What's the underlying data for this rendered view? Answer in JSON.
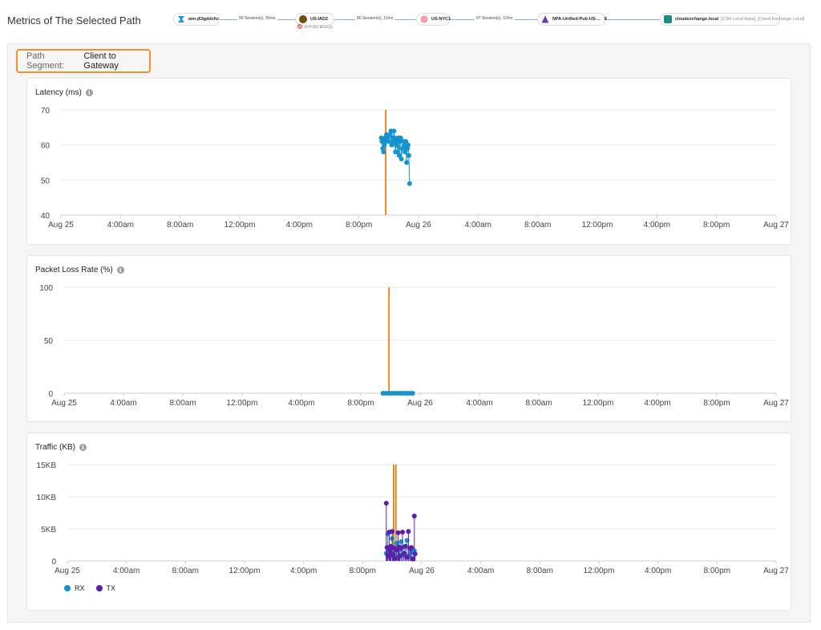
{
  "page_title": "Metrics of The Selected Path",
  "path": {
    "nodes": [
      {
        "id": "client",
        "label": "win-j63gddchz",
        "sub": "",
        "icon": "laptop-icon",
        "color": "#1e9ad6"
      },
      {
        "id": "gateway",
        "label": "US-IAD2",
        "sub": "",
        "icon": "gateway-icon",
        "color": "#7a4a12"
      },
      {
        "id": "pop",
        "label": "US-NYC1",
        "sub": "",
        "icon": "pop-icon",
        "color": "#f2a0b0"
      },
      {
        "id": "publisher",
        "label": "NPA-Unified-Pub-US-...",
        "sub": "",
        "icon": "publisher-icon",
        "color": "#6a3bb0"
      },
      {
        "id": "app",
        "label": "cloudexchange.local",
        "sub": "[CSH Local Apps], [Cloud Exchange Local]",
        "icon": "app-icon",
        "color": "#1a8a8a"
      }
    ],
    "connections": [
      "90 Session(s), 56ms",
      "80 Session(s), 11ms",
      "97 Session(s), 12ms",
      ""
    ],
    "policy_block": "10 Policy Block(s)",
    "publisher_count": "8"
  },
  "segment": {
    "label": "Path Segment:",
    "value": "Client to Gateway"
  },
  "colors": {
    "accent": "#f0912d",
    "rx": "#1593cc",
    "tx": "#5b1fa8",
    "marker": "#e8892a",
    "grid": "#e9e9e9"
  },
  "x_ticks": [
    "Aug 25",
    "4:00am",
    "8:00am",
    "12:00pm",
    "4:00pm",
    "8:00pm",
    "Aug 26",
    "4:00am",
    "8:00am",
    "12:00pm",
    "4:00pm",
    "8:00pm",
    "Aug 27"
  ],
  "chart_data": [
    {
      "type": "scatter",
      "title": "Latency (ms)",
      "ylim": [
        40,
        70
      ],
      "yticks": [
        "40",
        "50",
        "60",
        "70"
      ],
      "marker_hour": 21.8,
      "series": [
        {
          "values": [
            [
              21.5,
              62
            ],
            [
              21.55,
              61
            ],
            [
              21.6,
              59
            ],
            [
              21.65,
              58
            ],
            [
              21.7,
              60
            ],
            [
              21.75,
              62
            ],
            [
              21.8,
              61
            ],
            [
              21.85,
              63
            ],
            [
              21.9,
              62
            ],
            [
              22.0,
              61
            ],
            [
              22.1,
              63
            ],
            [
              22.15,
              64
            ],
            [
              22.2,
              60
            ],
            [
              22.25,
              62
            ],
            [
              22.3,
              61
            ],
            [
              22.35,
              64
            ],
            [
              22.4,
              62
            ],
            [
              22.45,
              58
            ],
            [
              22.5,
              60
            ],
            [
              22.55,
              61
            ],
            [
              22.6,
              58
            ],
            [
              22.65,
              62
            ],
            [
              22.7,
              57
            ],
            [
              22.75,
              61
            ],
            [
              22.8,
              62
            ],
            [
              22.85,
              56
            ],
            [
              22.9,
              59
            ],
            [
              23.0,
              61
            ],
            [
              23.05,
              60
            ],
            [
              23.1,
              58
            ],
            [
              23.15,
              61
            ],
            [
              23.2,
              55
            ],
            [
              23.25,
              59
            ],
            [
              23.3,
              60
            ],
            [
              23.35,
              57
            ],
            [
              23.4,
              49
            ]
          ]
        }
      ]
    },
    {
      "type": "scatter",
      "title": "Packet Loss Rate (%)",
      "ylim": [
        0,
        100
      ],
      "yticks": [
        "0",
        "50",
        "100"
      ],
      "marker_hour": 21.9,
      "series": [
        {
          "values": [
            [
              21.5,
              0
            ],
            [
              21.7,
              0
            ],
            [
              21.9,
              0
            ],
            [
              22.1,
              0
            ],
            [
              22.3,
              0
            ],
            [
              22.5,
              0
            ],
            [
              22.7,
              0
            ],
            [
              22.9,
              0
            ],
            [
              23.1,
              0
            ],
            [
              23.3,
              0
            ],
            [
              23.5,
              0
            ]
          ]
        }
      ]
    },
    {
      "type": "scatter",
      "title": "Traffic (KB)",
      "ylim": [
        0,
        15
      ],
      "yticks": [
        "0",
        "5KB",
        "10KB",
        "15KB"
      ],
      "marker_hours": [
        22.1,
        22.25
      ],
      "series": [
        {
          "name": "RX",
          "values": [
            [
              21.6,
              1.2
            ],
            [
              21.7,
              4.2
            ],
            [
              21.8,
              0.6
            ],
            [
              21.9,
              2.0
            ],
            [
              22.0,
              3.5
            ],
            [
              22.1,
              0.8
            ],
            [
              22.2,
              1.5
            ],
            [
              22.3,
              2.8
            ],
            [
              22.4,
              0.5
            ],
            [
              22.5,
              1.8
            ],
            [
              22.6,
              3.0
            ],
            [
              22.7,
              0.9
            ],
            [
              22.8,
              2.2
            ],
            [
              22.9,
              1.0
            ],
            [
              23.0,
              3.2
            ],
            [
              23.1,
              0.7
            ],
            [
              23.2,
              2.0
            ],
            [
              23.3,
              1.3
            ],
            [
              23.4,
              0.4
            ],
            [
              23.5,
              1.6
            ]
          ]
        },
        {
          "name": "TX",
          "values": [
            [
              21.6,
              9.0
            ],
            [
              21.65,
              2.1
            ],
            [
              21.7,
              0.9
            ],
            [
              21.8,
              4.5
            ],
            [
              21.85,
              1.6
            ],
            [
              21.9,
              2.3
            ],
            [
              22.0,
              4.6
            ],
            [
              22.05,
              1.0
            ],
            [
              22.1,
              2.1
            ],
            [
              22.2,
              0.4
            ],
            [
              22.3,
              1.7
            ],
            [
              22.4,
              4.4
            ],
            [
              22.45,
              2.2
            ],
            [
              22.5,
              0.8
            ],
            [
              22.6,
              2.0
            ],
            [
              22.7,
              4.5
            ],
            [
              22.8,
              1.2
            ],
            [
              22.9,
              2.3
            ],
            [
              23.0,
              0.6
            ],
            [
              23.1,
              4.6
            ],
            [
              23.2,
              1.9
            ],
            [
              23.3,
              2.1
            ],
            [
              23.4,
              0.3
            ],
            [
              23.5,
              7.0
            ],
            [
              23.55,
              1.1
            ]
          ]
        }
      ]
    }
  ]
}
